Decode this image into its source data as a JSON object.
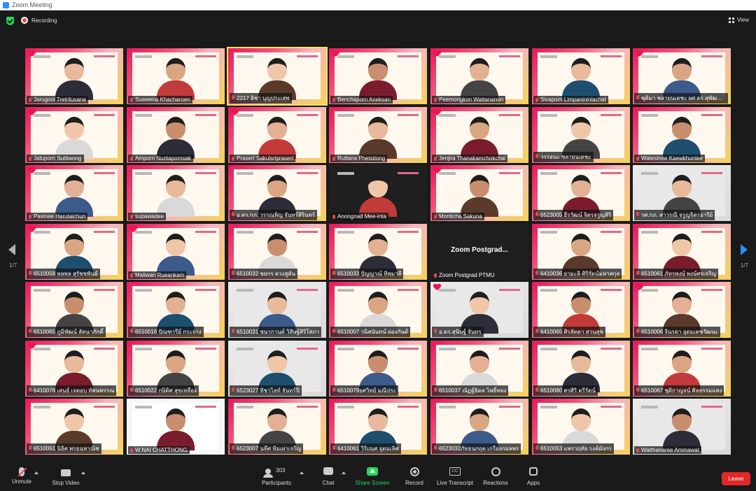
{
  "window": {
    "title": "Zoom Meeting"
  },
  "topbar": {
    "recording": "Recording",
    "view": "View"
  },
  "pagination": {
    "left": "1/7",
    "right": "1/7"
  },
  "participants": [
    "Jarugool Tretriluxana",
    "Suweena Khacharoen",
    "2217 ธิชา บุญประเสพ",
    "Benchaporn Aneksan",
    "Peemongkon Wattananon",
    "Sivaporn Limpanininlachat",
    "ชุติมา ชลายนเดชะ ผศ.ดร.สุพัฒน์ตัล",
    "Jatuporn Suttiwong",
    "Amporn Nuntapornsak",
    "Prasert Sakulsriprasert",
    "Ruttana Phetsitong",
    "Jenjira Thanakamchokchai",
    "วรรธนะ ชลายนเดชะ",
    "Watesinee Kaewkhuntee",
    "Pavinee Harutaichun",
    "supawadee",
    "อ.ดร.กภ. วรรณพิญ จันทร์สิรินทร์",
    "Anongnad Mee-inta",
    "Monticha Sakuna",
    "6523005 ธีรวัฒน์ จิตรจรูญสิริ",
    "รศ.กภ. สาวรณี จรูญจิตรอารีย์",
    "6510058 พลพล สุรัชชพันธ์",
    "Maliwan Rueankam",
    "6510032 ชยกร ตวงสูตัน",
    "6510033 ปัญญาณ์ ทิพมาลี",
    "Zoom Postgrad PTMU",
    "6410036 ยามะลิ ศิริรัตน์มหาสกุล",
    "6510061 ภัทรพงษ์ พงษ์ศรเจริญ",
    "6510065 ภูมิพัฒน์ ลัคนาภักดิ์",
    "6510016 ปัณฑารีย์ กระจาง",
    "6510031 ชนากานต์ วิสิษฐ์สิริโสภา",
    "6510007 วนิสนันทน์ ผ่องกันต์",
    "อ.ดร.สุนิษฐ์ จันทร",
    "6410065 ศิรลัดดา สวนสุข",
    "6510006 จินรดา อุดมเดชวัฒนะ",
    "6410076 เสนธ์ เจตอบ ทัศนพรรณ",
    "6510022 กษิดิศ สุขเหลือง",
    "6523027 ทิชาไลท์ จันทร์ปี",
    "6510079ยศวิทย์ มณีประ",
    "6510037 ณัฏฐ์ธิดล โพธิ์ทอง",
    "6510080 ศรศิริ ตรีรัตน์",
    "6510067 ชุติกาญจน์ ศิลธรรมแสง",
    "6510051 นิธิศ พรธนพาณิช",
    "W.NAI CHATTHONG",
    "6523007 นทีศ ทิมเผ่าเจริญ",
    "6410061 วิริเณศ อุดมเลิศ",
    "6523032ภัทธนกฤต เกรียงกมลพร",
    "6510053 แพรวฤทัย รงค์มังกร",
    "Watthanaree Ammawat"
  ],
  "zoom_tile": {
    "title": "Zoom  Postgrad..."
  },
  "toolbar": {
    "unmute": "Unmute",
    "stop_video": "Stop Video",
    "participants": "Participants",
    "participants_count": "303",
    "chat": "Chat",
    "share_screen": "Share Screen",
    "record": "Record",
    "live_transcript": "Live Transcript",
    "reactions": "Reactions",
    "apps": "Apps",
    "leave": "Leave"
  },
  "colors": {
    "accent": "#2d8cff",
    "share_green": "#23d959",
    "leave_red": "#e02828",
    "brand_pink": "#e8185a"
  }
}
